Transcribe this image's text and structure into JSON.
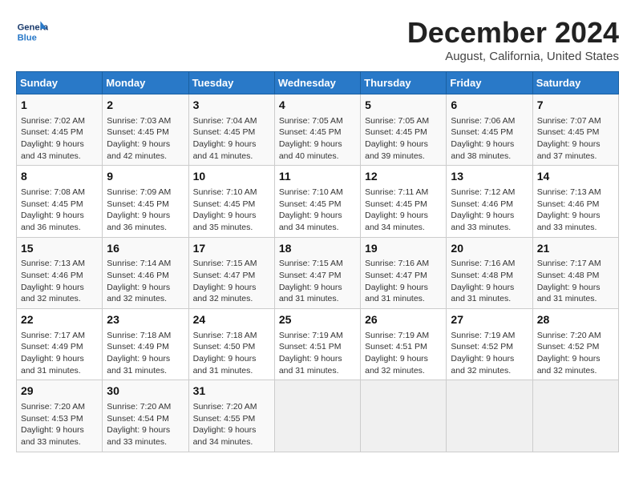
{
  "header": {
    "logo_general": "General",
    "logo_blue": "Blue",
    "month_title": "December 2024",
    "subtitle": "August, California, United States"
  },
  "days_of_week": [
    "Sunday",
    "Monday",
    "Tuesday",
    "Wednesday",
    "Thursday",
    "Friday",
    "Saturday"
  ],
  "weeks": [
    [
      {
        "day": "1",
        "sunrise": "Sunrise: 7:02 AM",
        "sunset": "Sunset: 4:45 PM",
        "daylight": "Daylight: 9 hours and 43 minutes."
      },
      {
        "day": "2",
        "sunrise": "Sunrise: 7:03 AM",
        "sunset": "Sunset: 4:45 PM",
        "daylight": "Daylight: 9 hours and 42 minutes."
      },
      {
        "day": "3",
        "sunrise": "Sunrise: 7:04 AM",
        "sunset": "Sunset: 4:45 PM",
        "daylight": "Daylight: 9 hours and 41 minutes."
      },
      {
        "day": "4",
        "sunrise": "Sunrise: 7:05 AM",
        "sunset": "Sunset: 4:45 PM",
        "daylight": "Daylight: 9 hours and 40 minutes."
      },
      {
        "day": "5",
        "sunrise": "Sunrise: 7:05 AM",
        "sunset": "Sunset: 4:45 PM",
        "daylight": "Daylight: 9 hours and 39 minutes."
      },
      {
        "day": "6",
        "sunrise": "Sunrise: 7:06 AM",
        "sunset": "Sunset: 4:45 PM",
        "daylight": "Daylight: 9 hours and 38 minutes."
      },
      {
        "day": "7",
        "sunrise": "Sunrise: 7:07 AM",
        "sunset": "Sunset: 4:45 PM",
        "daylight": "Daylight: 9 hours and 37 minutes."
      }
    ],
    [
      {
        "day": "8",
        "sunrise": "Sunrise: 7:08 AM",
        "sunset": "Sunset: 4:45 PM",
        "daylight": "Daylight: 9 hours and 36 minutes."
      },
      {
        "day": "9",
        "sunrise": "Sunrise: 7:09 AM",
        "sunset": "Sunset: 4:45 PM",
        "daylight": "Daylight: 9 hours and 36 minutes."
      },
      {
        "day": "10",
        "sunrise": "Sunrise: 7:10 AM",
        "sunset": "Sunset: 4:45 PM",
        "daylight": "Daylight: 9 hours and 35 minutes."
      },
      {
        "day": "11",
        "sunrise": "Sunrise: 7:10 AM",
        "sunset": "Sunset: 4:45 PM",
        "daylight": "Daylight: 9 hours and 34 minutes."
      },
      {
        "day": "12",
        "sunrise": "Sunrise: 7:11 AM",
        "sunset": "Sunset: 4:45 PM",
        "daylight": "Daylight: 9 hours and 34 minutes."
      },
      {
        "day": "13",
        "sunrise": "Sunrise: 7:12 AM",
        "sunset": "Sunset: 4:46 PM",
        "daylight": "Daylight: 9 hours and 33 minutes."
      },
      {
        "day": "14",
        "sunrise": "Sunrise: 7:13 AM",
        "sunset": "Sunset: 4:46 PM",
        "daylight": "Daylight: 9 hours and 33 minutes."
      }
    ],
    [
      {
        "day": "15",
        "sunrise": "Sunrise: 7:13 AM",
        "sunset": "Sunset: 4:46 PM",
        "daylight": "Daylight: 9 hours and 32 minutes."
      },
      {
        "day": "16",
        "sunrise": "Sunrise: 7:14 AM",
        "sunset": "Sunset: 4:46 PM",
        "daylight": "Daylight: 9 hours and 32 minutes."
      },
      {
        "day": "17",
        "sunrise": "Sunrise: 7:15 AM",
        "sunset": "Sunset: 4:47 PM",
        "daylight": "Daylight: 9 hours and 32 minutes."
      },
      {
        "day": "18",
        "sunrise": "Sunrise: 7:15 AM",
        "sunset": "Sunset: 4:47 PM",
        "daylight": "Daylight: 9 hours and 31 minutes."
      },
      {
        "day": "19",
        "sunrise": "Sunrise: 7:16 AM",
        "sunset": "Sunset: 4:47 PM",
        "daylight": "Daylight: 9 hours and 31 minutes."
      },
      {
        "day": "20",
        "sunrise": "Sunrise: 7:16 AM",
        "sunset": "Sunset: 4:48 PM",
        "daylight": "Daylight: 9 hours and 31 minutes."
      },
      {
        "day": "21",
        "sunrise": "Sunrise: 7:17 AM",
        "sunset": "Sunset: 4:48 PM",
        "daylight": "Daylight: 9 hours and 31 minutes."
      }
    ],
    [
      {
        "day": "22",
        "sunrise": "Sunrise: 7:17 AM",
        "sunset": "Sunset: 4:49 PM",
        "daylight": "Daylight: 9 hours and 31 minutes."
      },
      {
        "day": "23",
        "sunrise": "Sunrise: 7:18 AM",
        "sunset": "Sunset: 4:49 PM",
        "daylight": "Daylight: 9 hours and 31 minutes."
      },
      {
        "day": "24",
        "sunrise": "Sunrise: 7:18 AM",
        "sunset": "Sunset: 4:50 PM",
        "daylight": "Daylight: 9 hours and 31 minutes."
      },
      {
        "day": "25",
        "sunrise": "Sunrise: 7:19 AM",
        "sunset": "Sunset: 4:51 PM",
        "daylight": "Daylight: 9 hours and 31 minutes."
      },
      {
        "day": "26",
        "sunrise": "Sunrise: 7:19 AM",
        "sunset": "Sunset: 4:51 PM",
        "daylight": "Daylight: 9 hours and 32 minutes."
      },
      {
        "day": "27",
        "sunrise": "Sunrise: 7:19 AM",
        "sunset": "Sunset: 4:52 PM",
        "daylight": "Daylight: 9 hours and 32 minutes."
      },
      {
        "day": "28",
        "sunrise": "Sunrise: 7:20 AM",
        "sunset": "Sunset: 4:52 PM",
        "daylight": "Daylight: 9 hours and 32 minutes."
      }
    ],
    [
      {
        "day": "29",
        "sunrise": "Sunrise: 7:20 AM",
        "sunset": "Sunset: 4:53 PM",
        "daylight": "Daylight: 9 hours and 33 minutes."
      },
      {
        "day": "30",
        "sunrise": "Sunrise: 7:20 AM",
        "sunset": "Sunset: 4:54 PM",
        "daylight": "Daylight: 9 hours and 33 minutes."
      },
      {
        "day": "31",
        "sunrise": "Sunrise: 7:20 AM",
        "sunset": "Sunset: 4:55 PM",
        "daylight": "Daylight: 9 hours and 34 minutes."
      },
      {
        "day": "",
        "sunrise": "",
        "sunset": "",
        "daylight": ""
      },
      {
        "day": "",
        "sunrise": "",
        "sunset": "",
        "daylight": ""
      },
      {
        "day": "",
        "sunrise": "",
        "sunset": "",
        "daylight": ""
      },
      {
        "day": "",
        "sunrise": "",
        "sunset": "",
        "daylight": ""
      }
    ]
  ]
}
